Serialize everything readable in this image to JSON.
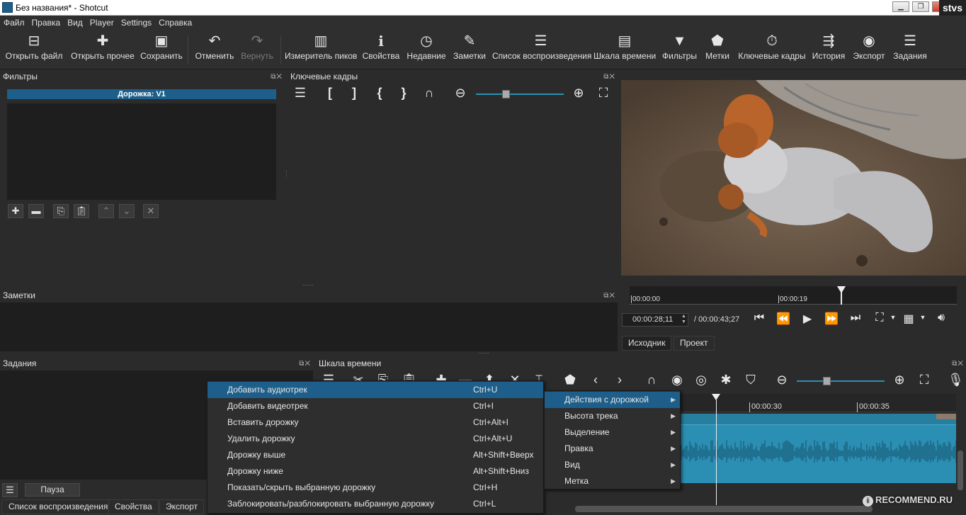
{
  "window": {
    "title": "Без названия* - Shotcut",
    "corner_user": "stvs"
  },
  "menubar": [
    "Файл",
    "Правка",
    "Вид",
    "Player",
    "Settings",
    "Справка"
  ],
  "toolbar": [
    {
      "label": "Открыть файл",
      "icon": "folder-open-icon",
      "glyph": "▭"
    },
    {
      "label": "Открыть прочее",
      "icon": "open-other-icon",
      "glyph": "✚"
    },
    {
      "label": "Сохранить",
      "icon": "save-icon",
      "glyph": "▣"
    },
    {
      "label": "Отменить",
      "icon": "undo-icon",
      "glyph": "↶"
    },
    {
      "label": "Вернуть",
      "icon": "redo-icon",
      "glyph": "↷"
    },
    {
      "label": "Измеритель пиков",
      "icon": "peak-meter-icon",
      "glyph": "▥"
    },
    {
      "label": "Свойства",
      "icon": "info-icon",
      "glyph": "i"
    },
    {
      "label": "Недавние",
      "icon": "clock-icon",
      "glyph": "◷"
    },
    {
      "label": "Заметки",
      "icon": "notes-icon",
      "glyph": "✎"
    },
    {
      "label": "Список воспроизведения",
      "icon": "playlist-icon",
      "glyph": "☰"
    },
    {
      "label": "Шкала времени",
      "icon": "timeline-icon",
      "glyph": "▤"
    },
    {
      "label": "Фильтры",
      "icon": "filter-icon",
      "glyph": "▼"
    },
    {
      "label": "Метки",
      "icon": "marker-icon",
      "glyph": "⬟"
    },
    {
      "label": "Ключевые кадры",
      "icon": "stopwatch-icon",
      "glyph": "⏱"
    },
    {
      "label": "История",
      "icon": "history-icon",
      "glyph": "≡"
    },
    {
      "label": "Экспорт",
      "icon": "export-disc-icon",
      "glyph": "◉"
    },
    {
      "label": "Задания",
      "icon": "jobs-stack-icon",
      "glyph": "☰"
    }
  ],
  "filters": {
    "title": "Фильтры",
    "track_label": "Дорожка: V1"
  },
  "keyframes": {
    "title": "Ключевые кадры"
  },
  "notes": {
    "title": "Заметки"
  },
  "jobs": {
    "title": "Задания",
    "pause_label": "Пауза"
  },
  "timeline": {
    "title": "Шкала времени",
    "ruler": [
      "00:00:30",
      "00:00:35"
    ]
  },
  "player": {
    "ruler": [
      "00:00:00",
      "00:00:19"
    ],
    "current_time": "00:00:28;11",
    "total_time": "/ 00:00:43;27",
    "tabs": [
      "Исходник",
      "Проект"
    ]
  },
  "bottom_tabs": [
    "Список воспроизведения",
    "Свойства",
    "Экспорт"
  ],
  "context_menu": [
    {
      "label": "Добавить аудиотрек",
      "shortcut": "Ctrl+U"
    },
    {
      "label": "Добавить видеотрек",
      "shortcut": "Ctrl+I"
    },
    {
      "label": "Вставить дорожку",
      "shortcut": "Ctrl+Alt+I"
    },
    {
      "label": "Удалить дорожку",
      "shortcut": "Ctrl+Alt+U"
    },
    {
      "label": "Дорожку выше",
      "shortcut": "Alt+Shift+Вверх"
    },
    {
      "label": "Дорожку ниже",
      "shortcut": "Alt+Shift+Вниз"
    },
    {
      "label": "Показать/скрыть выбранную дорожку",
      "shortcut": "Ctrl+H"
    },
    {
      "label": "Заблокировать/разблокировать выбранную дорожку",
      "shortcut": "Ctrl+L"
    }
  ],
  "submenu": [
    "Действия с дорожкой",
    "Высота трека",
    "Выделение",
    "Правка",
    "Вид",
    "Метка"
  ],
  "watermark": "RECOMMEND.RU",
  "colors": {
    "accent": "#1d5f8a",
    "waveform": "#2b8fb4"
  }
}
